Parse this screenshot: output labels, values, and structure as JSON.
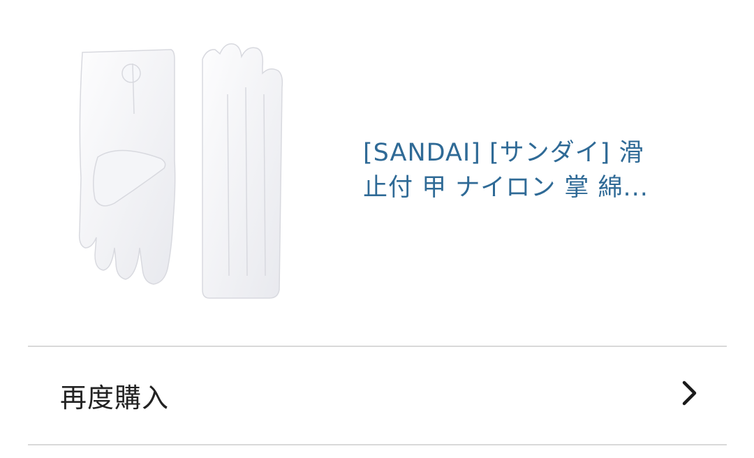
{
  "product": {
    "title_line1": "[SANDAI] [サンダイ] 滑",
    "title_line2": "止付 甲 ナイロン 掌 綿...",
    "image_icon": "white-gloves-image",
    "title_color": "#2f6a96"
  },
  "actions": {
    "rebuy_label": "再度購入",
    "chevron_icon": "chevron-right-icon"
  }
}
